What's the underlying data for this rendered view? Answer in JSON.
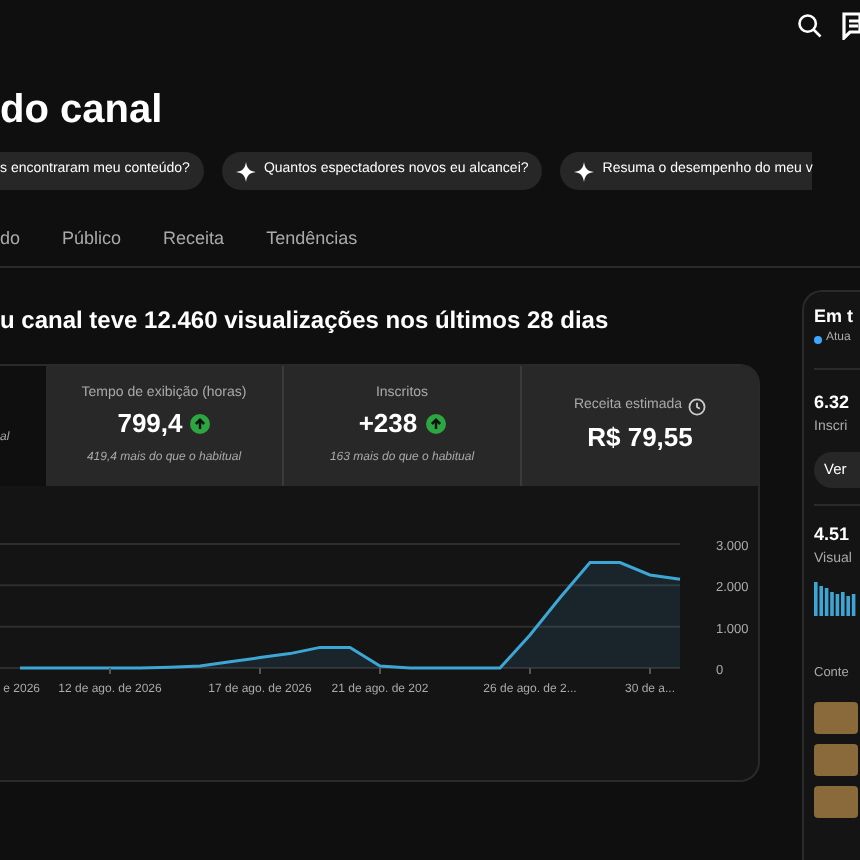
{
  "page_title": "do canal",
  "suggestions": [
    {
      "text": "s encontraram meu conteúdo?",
      "icon": false
    },
    {
      "text": "Quantos espectadores novos eu alcancei?",
      "icon": true
    },
    {
      "text": "Resuma o desempenho do meu v",
      "icon": true
    }
  ],
  "tabs": [
    {
      "label": "do",
      "selected": false
    },
    {
      "label": "Público",
      "selected": false
    },
    {
      "label": "Receita",
      "selected": false
    },
    {
      "label": "Tendências",
      "selected": false
    }
  ],
  "headline": "u canal teve 12.460 visualizações nos últimos 28 dias",
  "metrics": [
    {
      "selected": true,
      "note": "al"
    },
    {
      "selected": false,
      "label": "Tempo de exibição (horas)",
      "value": "799,4",
      "rising": true,
      "note": "419,4 mais do que o habitual"
    },
    {
      "selected": false,
      "label": "Inscritos",
      "value": "+238",
      "rising": true,
      "note": "163 mais do que o habitual"
    },
    {
      "selected": false,
      "label": "Receita estimada",
      "value": "R$ 79,55",
      "info": true
    }
  ],
  "chart_data": {
    "type": "area",
    "categories": [
      "e 2026",
      null,
      null,
      "12 de ago. de 2026",
      null,
      null,
      null,
      null,
      "17 de ago. de 2026",
      null,
      null,
      null,
      "21 de ago. de 202",
      null,
      null,
      null,
      null,
      "26 de ago. de 2...",
      null,
      null,
      null,
      "30 de a...",
      null
    ],
    "series": [
      {
        "color": "#3ea6d4",
        "values": [
          0,
          0,
          0,
          0,
          0,
          20,
          50,
          150,
          250,
          350,
          500,
          500,
          50,
          0,
          0,
          0,
          0,
          800,
          1700,
          2550,
          2550,
          2250,
          2150
        ]
      }
    ],
    "ylim": [
      0,
      3000
    ],
    "yticks": [
      {
        "value": 0,
        "label": "0"
      },
      {
        "value": 1000,
        "label": "1.000"
      },
      {
        "value": 2000,
        "label": "2.000"
      },
      {
        "value": 3000,
        "label": "3.000"
      }
    ]
  },
  "realtime": {
    "title": "Em t",
    "status": "Atua",
    "subscribers": "6.32",
    "subscribers_label": "Inscri",
    "button": "Ver",
    "views": "4.51",
    "views_label": "Visual",
    "content_label": "Conte"
  }
}
